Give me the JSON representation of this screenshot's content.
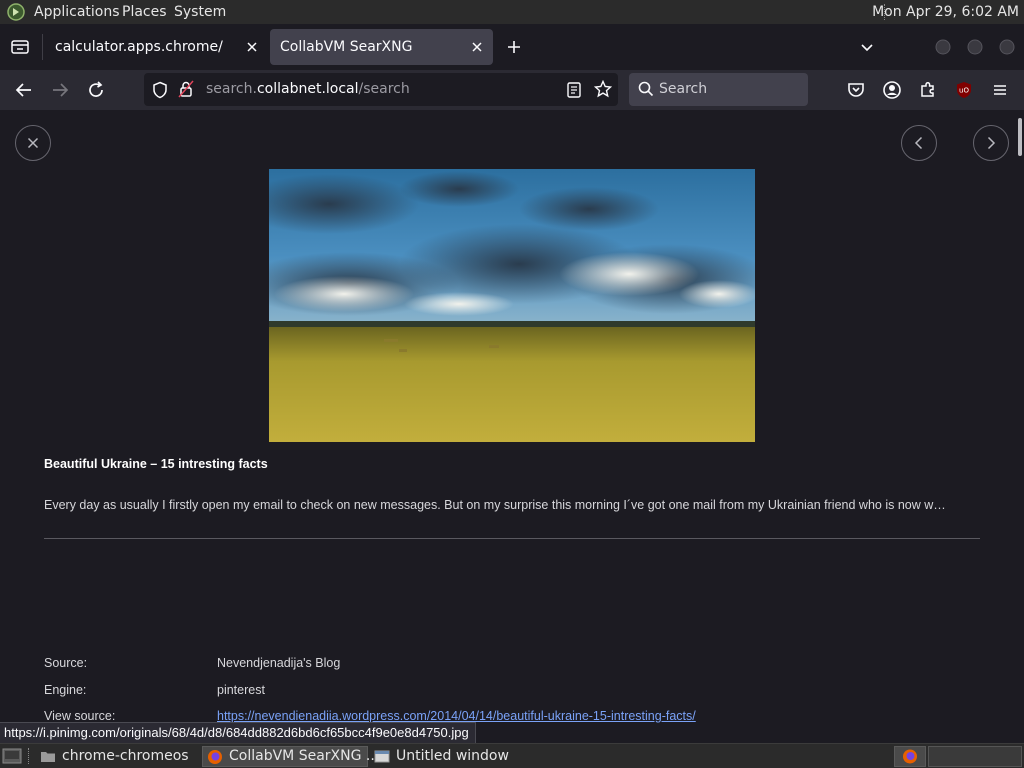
{
  "panel": {
    "menus": [
      "Applications",
      "Places",
      "System"
    ],
    "clock": "Mon Apr 29,  6:02 AM"
  },
  "tabs": [
    {
      "title": "calculator.apps.chrome/"
    },
    {
      "title": "CollabVM SearXNG"
    }
  ],
  "urlbar": {
    "prefix": "search.",
    "host": "collabnet.local",
    "path": "/search"
  },
  "searchbar": {
    "placeholder": "Search"
  },
  "result": {
    "title": "Beautiful Ukraine – 15 intresting facts",
    "description": "Every day as usually I firstly open my email to check on new messages. But on my surprise this morning I´ve got one mail from my Ukrainian friend who is now w…",
    "meta": [
      {
        "key": "Source:",
        "value": "Nevendjenadija's Blog"
      },
      {
        "key": "Engine:",
        "value": "pinterest"
      },
      {
        "key": "View source:",
        "value": "https://nevendienadiia.wordpress.com/2014/04/14/beautiful-ukraine-15-intresting-facts/"
      }
    ]
  },
  "status_url": "https://i.pinimg.com/originals/68/4d/d8/684dd882d6bd6cf65bcc4f9e0e8d4750.jpg",
  "taskbar": {
    "tasks": [
      {
        "label": "chrome-chromeos"
      },
      {
        "label": "CollabVM SearXNG ..."
      },
      {
        "label": "Untitled window"
      }
    ]
  }
}
